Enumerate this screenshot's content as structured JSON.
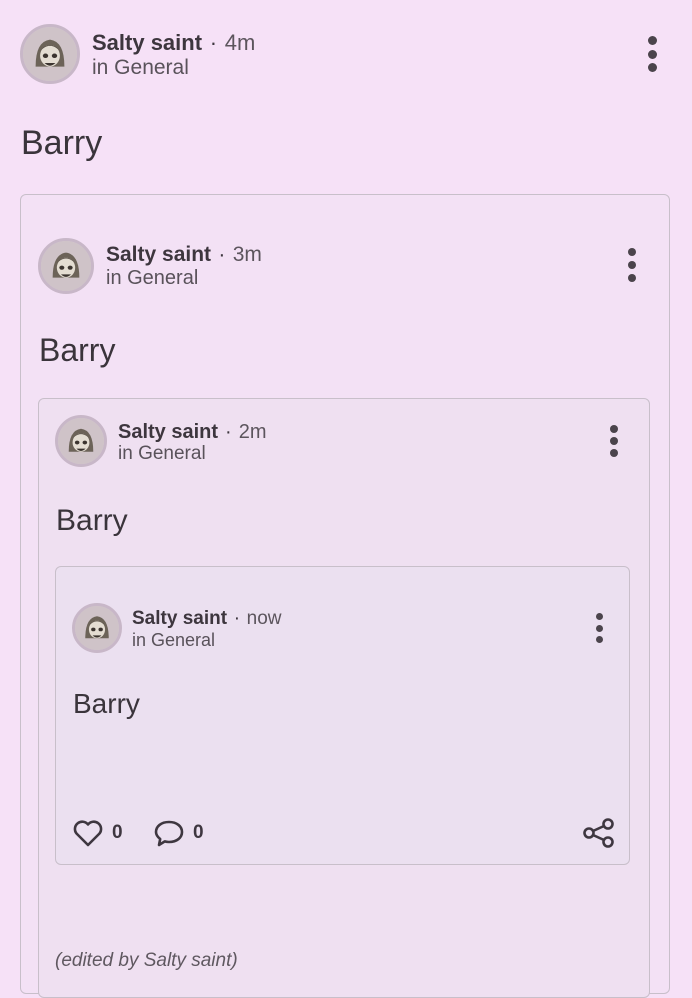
{
  "post1": {
    "author": "Salty saint",
    "separator": "·",
    "time": "4m",
    "community": "in General",
    "title": "Barry"
  },
  "post2": {
    "author": "Salty saint",
    "separator": "·",
    "time": "3m",
    "community": "in General",
    "title": "Barry"
  },
  "post3": {
    "author": "Salty saint",
    "separator": "·",
    "time": "2m",
    "community": "in General",
    "title": "Barry"
  },
  "post4": {
    "author": "Salty saint",
    "separator": "·",
    "time": "now",
    "community": "in General",
    "title": "Barry",
    "likes": "0",
    "comments": "0"
  },
  "edited_note": "(edited by Salty saint)",
  "icons": {
    "more": "more-vert-icon",
    "like": "heart-icon",
    "comment": "comment-icon",
    "share": "share-icon"
  }
}
